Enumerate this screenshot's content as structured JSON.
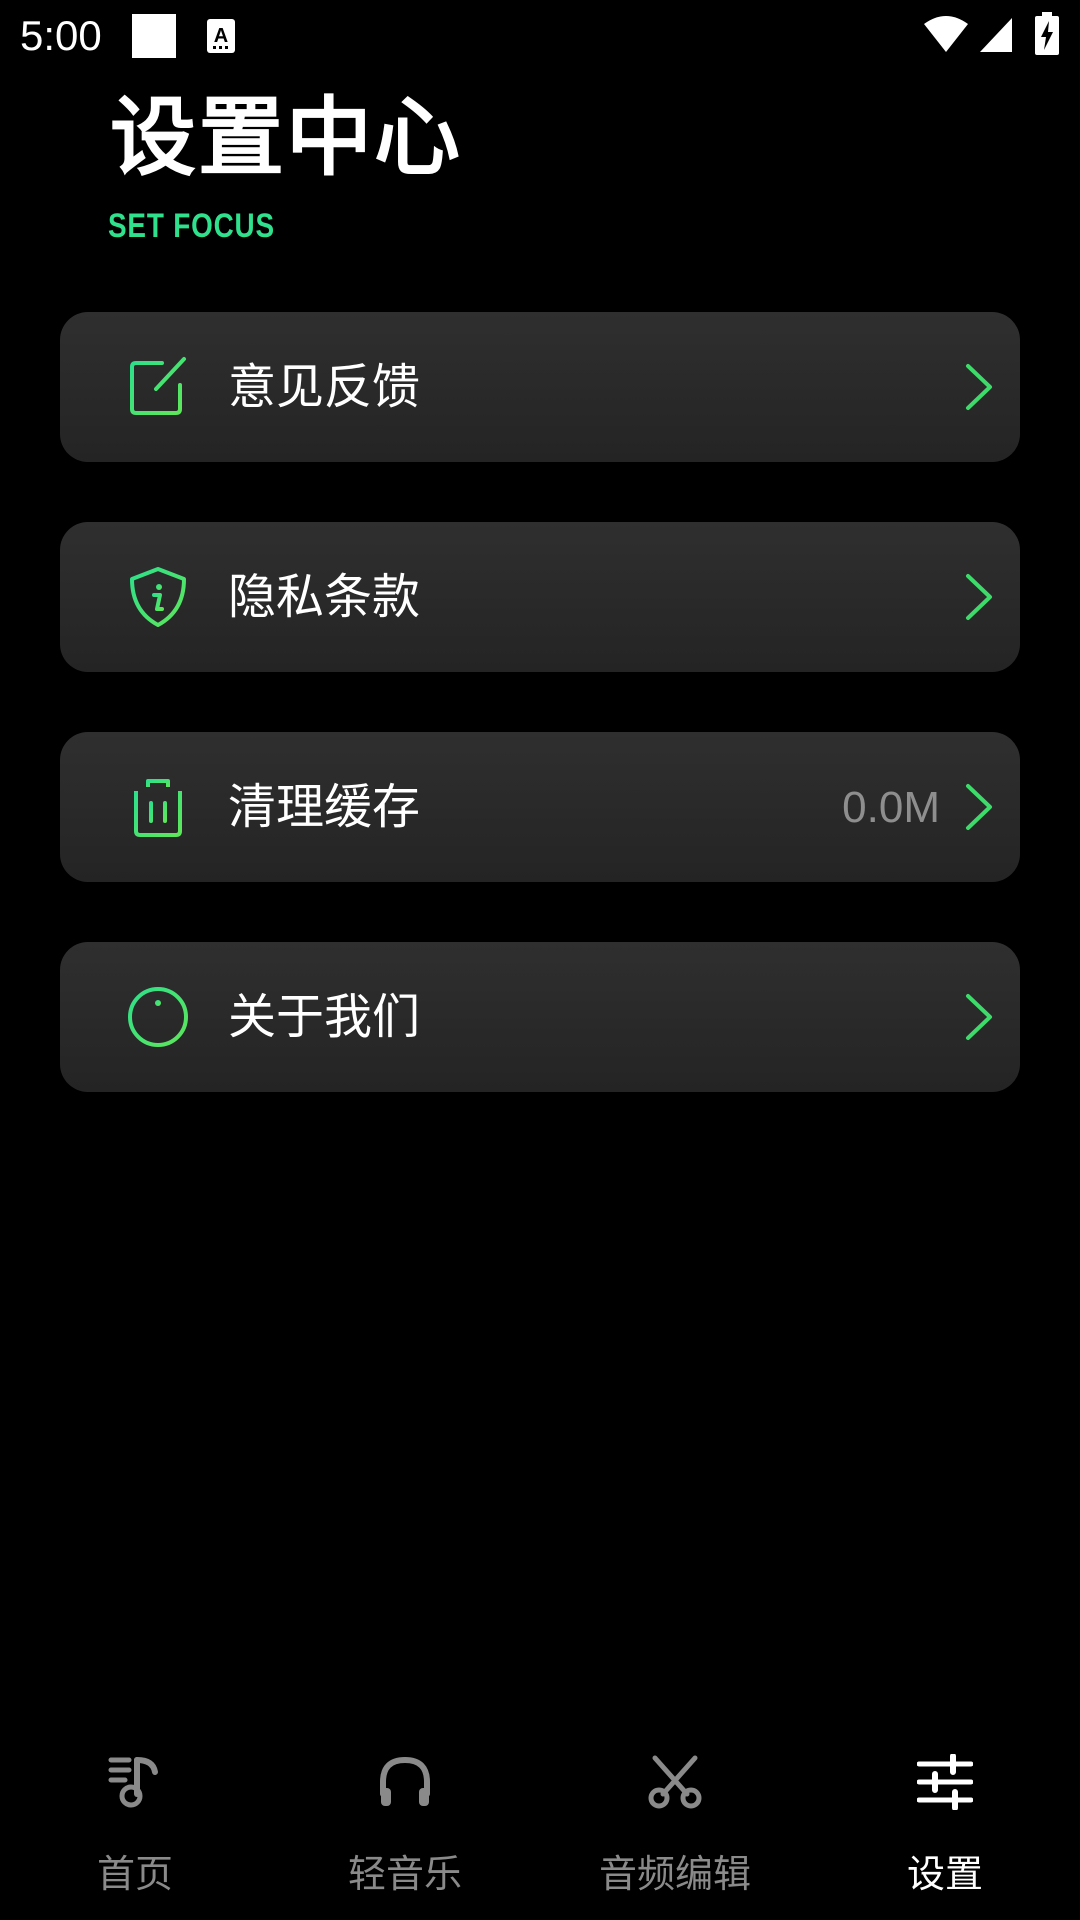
{
  "status_bar": {
    "time": "5:00",
    "icons": [
      "notification-square-icon",
      "font-a-icon",
      "wifi-icon",
      "signal-icon",
      "battery-charging-icon"
    ]
  },
  "header": {
    "title": "设置中心",
    "subtitle": "SET FOCUS"
  },
  "menu": {
    "items": [
      {
        "label": "意见反馈",
        "icon": "edit-note-icon",
        "value": ""
      },
      {
        "label": "隐私条款",
        "icon": "shield-info-icon",
        "value": ""
      },
      {
        "label": "清理缓存",
        "icon": "trash-icon",
        "value": "0.0M"
      },
      {
        "label": "关于我们",
        "icon": "info-circle-icon",
        "value": ""
      }
    ]
  },
  "bottom_nav": {
    "items": [
      {
        "label": "首页",
        "icon": "music-note-icon",
        "active": false
      },
      {
        "label": "轻音乐",
        "icon": "headphones-icon",
        "active": false
      },
      {
        "label": "音频编辑",
        "icon": "scissors-icon",
        "active": false
      },
      {
        "label": "设置",
        "icon": "sliders-icon",
        "active": true
      }
    ]
  },
  "colors": {
    "background": "#000000",
    "card": "#2a2a2a",
    "accent_green": "#3ddc6a",
    "subtitle_green": "#2fe08c",
    "inactive_text": "#8a8a8a",
    "value_text": "#8e8e8e"
  }
}
